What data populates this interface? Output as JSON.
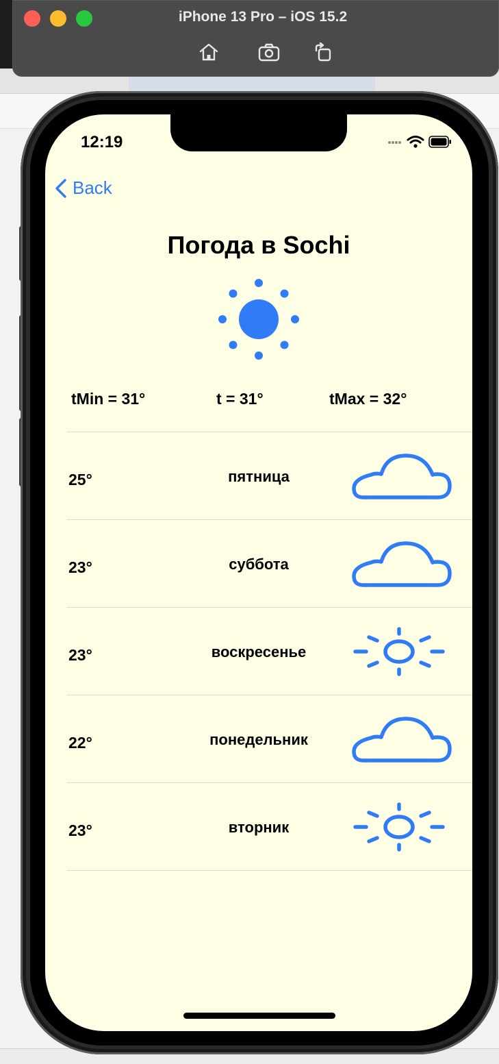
{
  "simulator": {
    "title": "iPhone 13 Pro – iOS 15.2",
    "buttons": [
      "home-icon",
      "screenshot-icon",
      "rotate-icon"
    ]
  },
  "status_bar": {
    "time": "12:19"
  },
  "nav": {
    "back_label": "Back"
  },
  "weather": {
    "title": "Погода в Sochi",
    "current_icon": "sun-max-fill-icon",
    "tmin_label": "tMin = 31°",
    "t_label": "t = 31°",
    "tmax_label": "tMax = 32°"
  },
  "forecast": [
    {
      "temp": "25°",
      "day": "пятница",
      "icon": "cloud-icon"
    },
    {
      "temp": "23°",
      "day": "суббота",
      "icon": "cloud-icon"
    },
    {
      "temp": "23°",
      "day": "воскресенье",
      "icon": "sun-icon"
    },
    {
      "temp": "22°",
      "day": "понедельник",
      "icon": "cloud-icon"
    },
    {
      "temp": "23°",
      "day": "вторник",
      "icon": "sun-icon"
    }
  ],
  "colors": {
    "accent": "#2f7cf6",
    "screen_bg": "#fefee5"
  }
}
